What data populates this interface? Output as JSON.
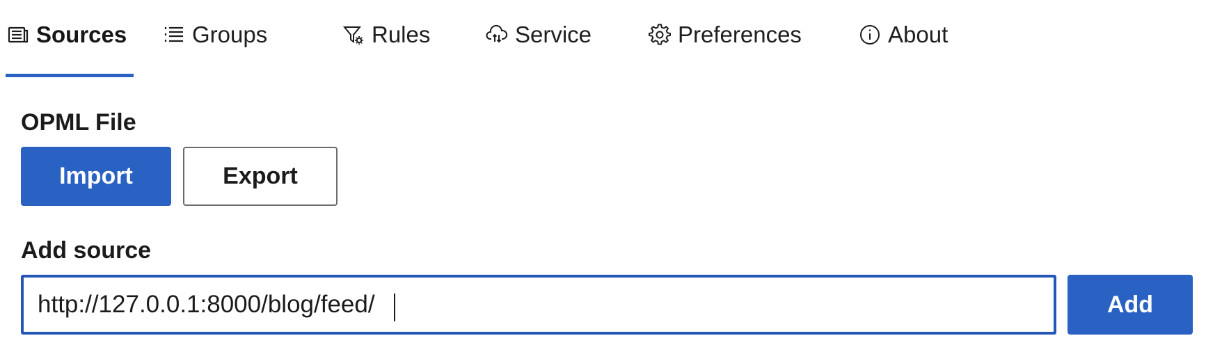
{
  "tabs": [
    {
      "label": "Sources",
      "icon": "sources-icon",
      "active": true
    },
    {
      "label": "Groups",
      "icon": "list-icon",
      "active": false
    },
    {
      "label": "Rules",
      "icon": "filter-gear-icon",
      "active": false
    },
    {
      "label": "Service",
      "icon": "cloud-sync-icon",
      "active": false
    },
    {
      "label": "Preferences",
      "icon": "gear-icon",
      "active": false
    },
    {
      "label": "About",
      "icon": "info-icon",
      "active": false
    }
  ],
  "opml": {
    "title": "OPML File",
    "import_label": "Import",
    "export_label": "Export"
  },
  "add_source": {
    "title": "Add source",
    "input_value": "http://127.0.0.1:8000/blog/feed/",
    "add_label": "Add"
  },
  "colors": {
    "accent": "#2a62c4",
    "text": "#1b1b1b",
    "border": "#6b6b6b"
  }
}
